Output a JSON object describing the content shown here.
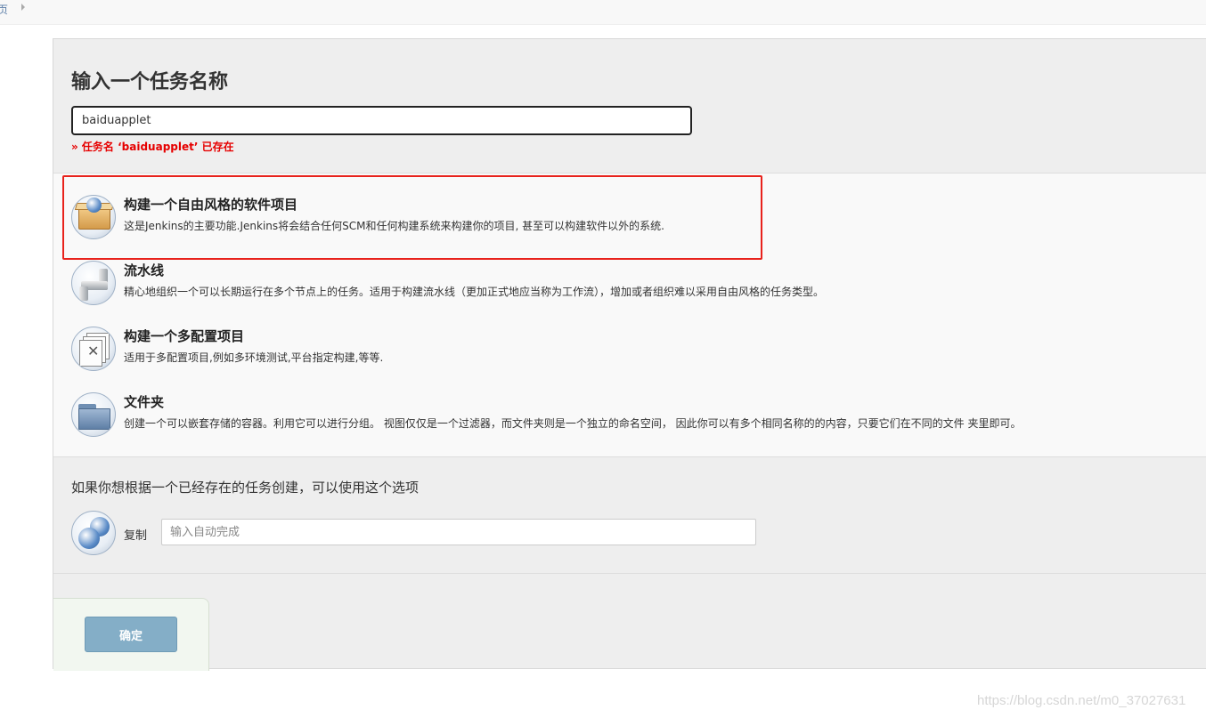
{
  "breadcrumb": {
    "home": "页"
  },
  "new_item": {
    "title": "输入一个任务名称",
    "name_value": "baiduapplet",
    "error": "» 任务名 ‘baiduapplet’ 已存在"
  },
  "item_types": [
    {
      "label": "构建一个自由风格的软件项目",
      "description": "这是Jenkins的主要功能.Jenkins将会结合任何SCM和任何构建系统来构建你的项目, 甚至可以构建软件以外的系统.",
      "icon": "freestyle-box-icon"
    },
    {
      "label": "流水线",
      "description": "精心地组织一个可以长期运行在多个节点上的任务。适用于构建流水线（更加正式地应当称为工作流），增加或者组织难以采用自由风格的任务类型。",
      "icon": "pipeline-icon"
    },
    {
      "label": "构建一个多配置项目",
      "description": "适用于多配置项目,例如多环境测试,平台指定构建,等等.",
      "icon": "multi-config-icon"
    },
    {
      "label": "文件夹",
      "description": "创建一个可以嵌套存储的容器。利用它可以进行分组。 视图仅仅是一个过滤器，而文件夹则是一个独立的命名空间， 因此你可以有多个相同名称的的内容，只要它们在不同的文件 夹里即可。",
      "icon": "folder-icon"
    }
  ],
  "copy": {
    "title": "如果你想根据一个已经存在的任务创建，可以使用这个选项",
    "label": "复制",
    "placeholder": "输入自动完成"
  },
  "ok_button": "确定",
  "watermark": "https://blog.csdn.net/m0_37027631",
  "colors": {
    "highlight": "#e8221c",
    "error": "#e60000",
    "ok_button": "#84aec7"
  }
}
